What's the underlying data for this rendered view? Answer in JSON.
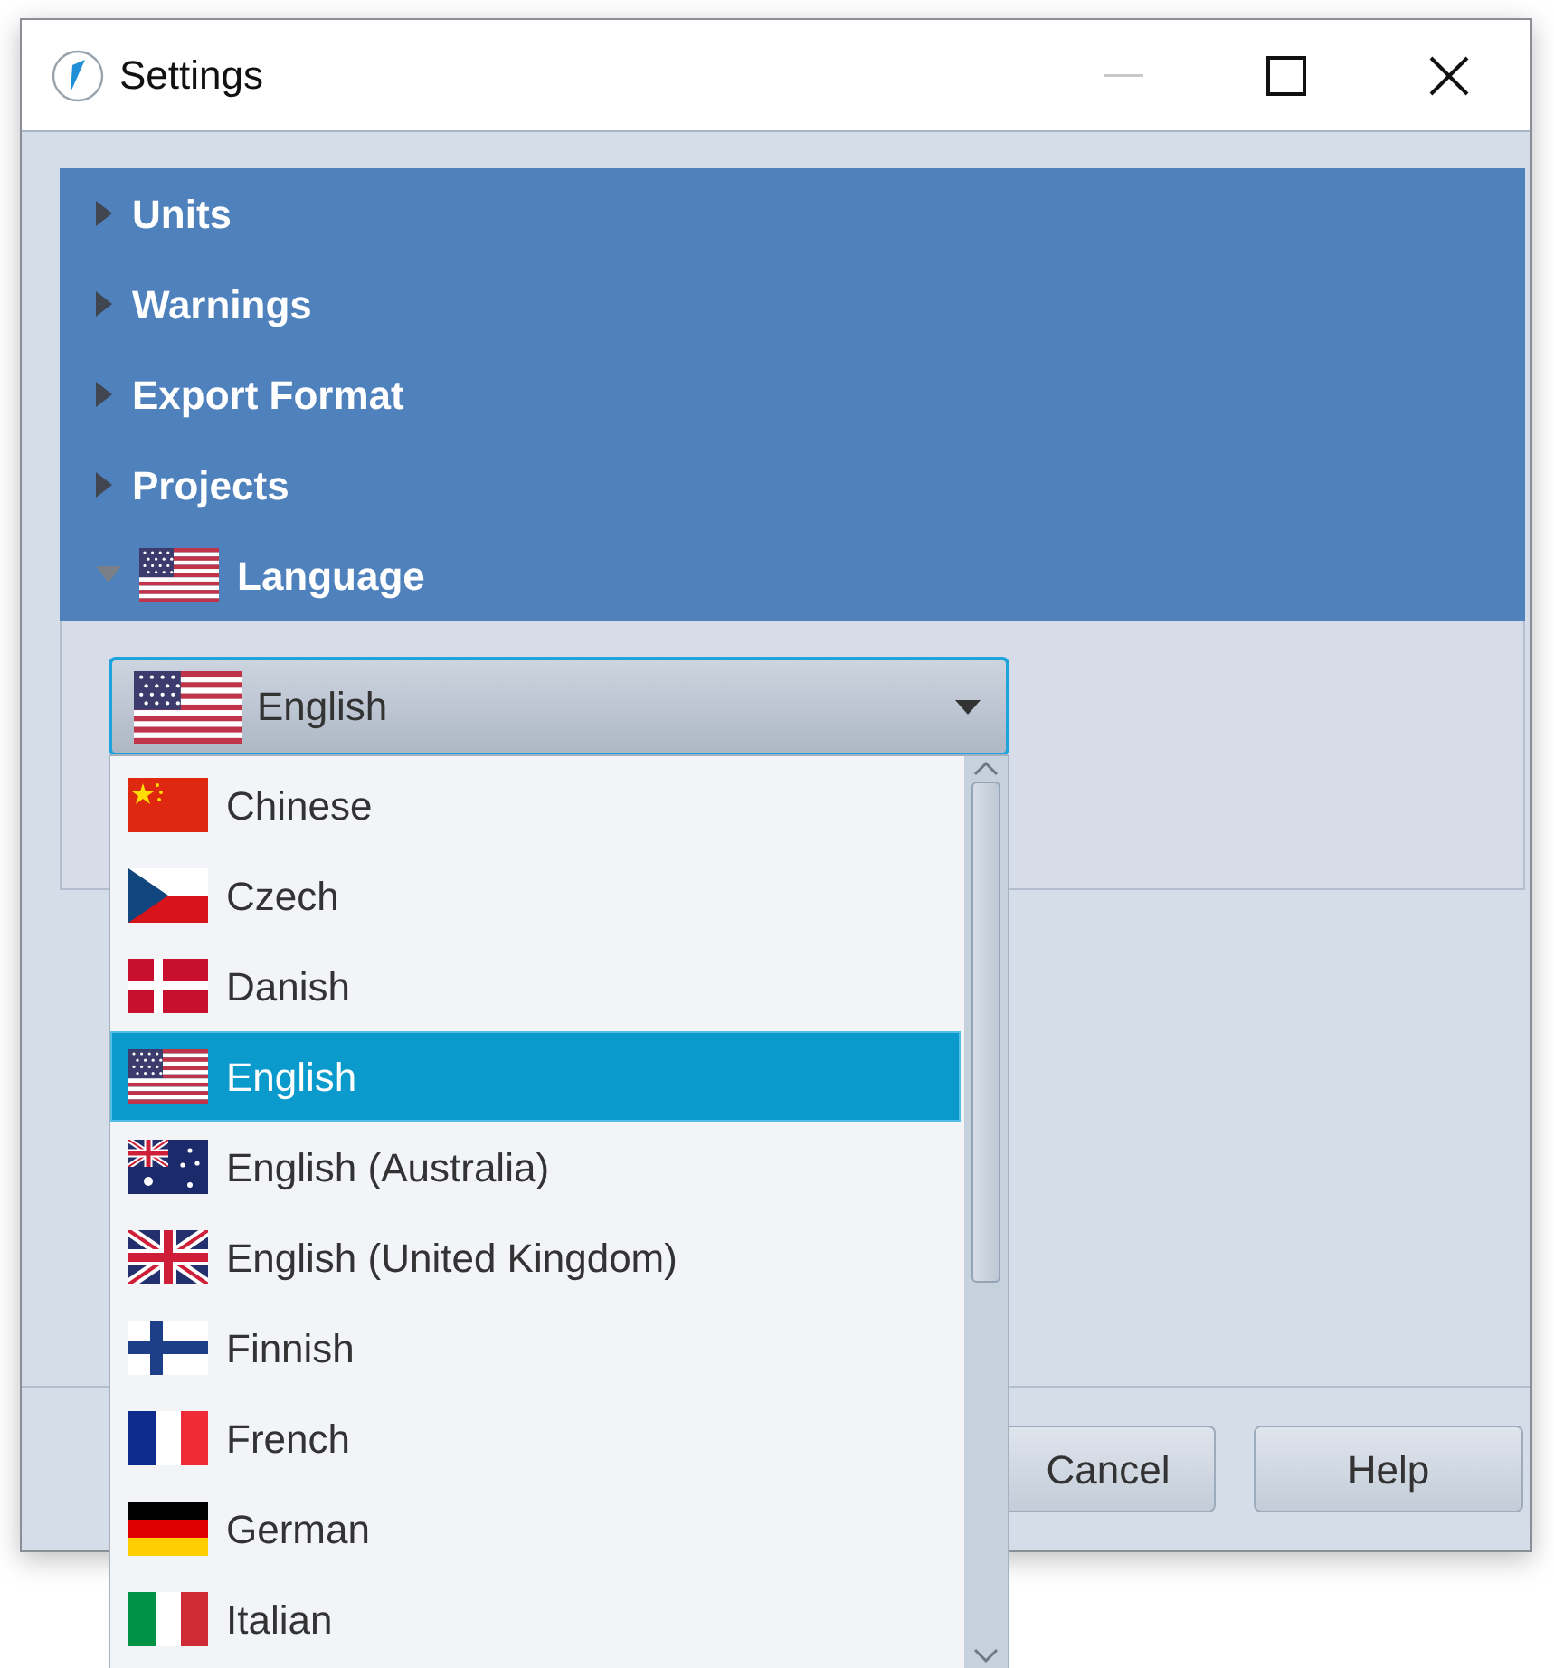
{
  "window": {
    "title": "Settings",
    "controls": [
      {
        "kind": "minimize",
        "disabled": true
      },
      {
        "kind": "maximize",
        "disabled": false
      },
      {
        "kind": "close",
        "disabled": false
      }
    ]
  },
  "sections": [
    {
      "label": "Units",
      "expanded": false
    },
    {
      "label": "Warnings",
      "expanded": false
    },
    {
      "label": "Export Format",
      "expanded": false
    },
    {
      "label": "Projects",
      "expanded": false
    },
    {
      "label": "Language",
      "expanded": true
    }
  ],
  "language_combo": {
    "value": "English",
    "open": true
  },
  "language_options": [
    {
      "label": "Chinese",
      "selected": false
    },
    {
      "label": "Czech",
      "selected": false
    },
    {
      "label": "Danish",
      "selected": false
    },
    {
      "label": "English",
      "selected": true
    },
    {
      "label": "English (Australia)",
      "selected": false
    },
    {
      "label": "English (United Kingdom)",
      "selected": false
    },
    {
      "label": "Finnish",
      "selected": false
    },
    {
      "label": "French",
      "selected": false
    },
    {
      "label": "German",
      "selected": false
    },
    {
      "label": "Italian",
      "selected": false
    }
  ],
  "buttons": [
    "Cancel",
    "Help"
  ]
}
